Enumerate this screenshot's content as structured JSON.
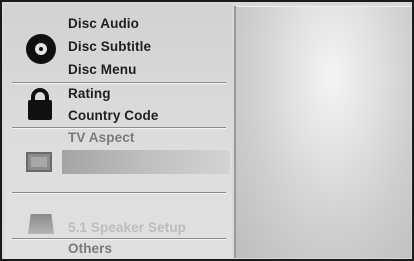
{
  "menu": {
    "disc_group": {
      "icon": "disc-icon",
      "items": [
        "Disc Audio",
        "Disc Subtitle",
        "Disc Menu"
      ]
    },
    "lock_group": {
      "icon": "lock-icon",
      "items": [
        "Rating",
        "Country Code"
      ]
    },
    "tv_group": {
      "icon": "tv-icon",
      "items": [
        "TV Aspect"
      ]
    },
    "speaker_group": {
      "icon": "speaker-icon",
      "items": [
        "5.1 Speaker Setup"
      ]
    },
    "others_label": "Others"
  },
  "colors": {
    "text_active": "#1f1f1f",
    "text_dim": "#7a7a7a",
    "panel_bg": "#d8d8d8",
    "highlight": "#b4b4b4"
  }
}
